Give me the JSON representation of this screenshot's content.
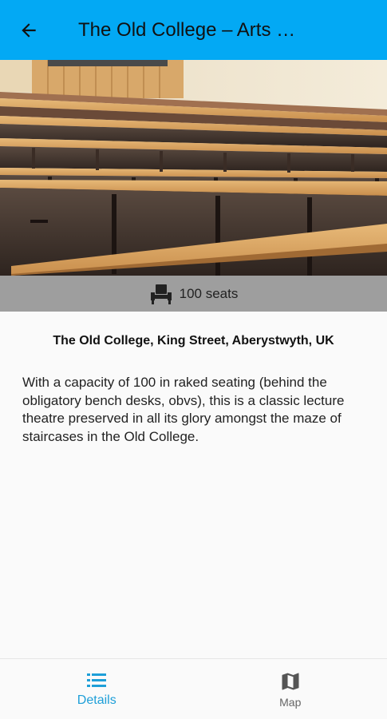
{
  "appbar": {
    "title": "The Old College – Arts …",
    "back_icon": "arrow-back-icon",
    "background": "#03a9f4"
  },
  "hero": {
    "image_subject": "lecture theatre seats"
  },
  "seats": {
    "icon": "seat-icon",
    "label": "100 seats"
  },
  "details": {
    "address": "The Old College, King Street, Aberystwyth, UK",
    "description": "With a capacity of 100 in raked seating (behind the obligatory bench desks, obvs), this is a classic lecture theatre preserved in all its glory amongst the maze of staircases in the Old College."
  },
  "bottom_nav": {
    "items": [
      {
        "label": "Details",
        "icon": "list-icon",
        "active": true
      },
      {
        "label": "Map",
        "icon": "map-icon",
        "active": false
      }
    ],
    "active_color": "#1e9fd8"
  }
}
